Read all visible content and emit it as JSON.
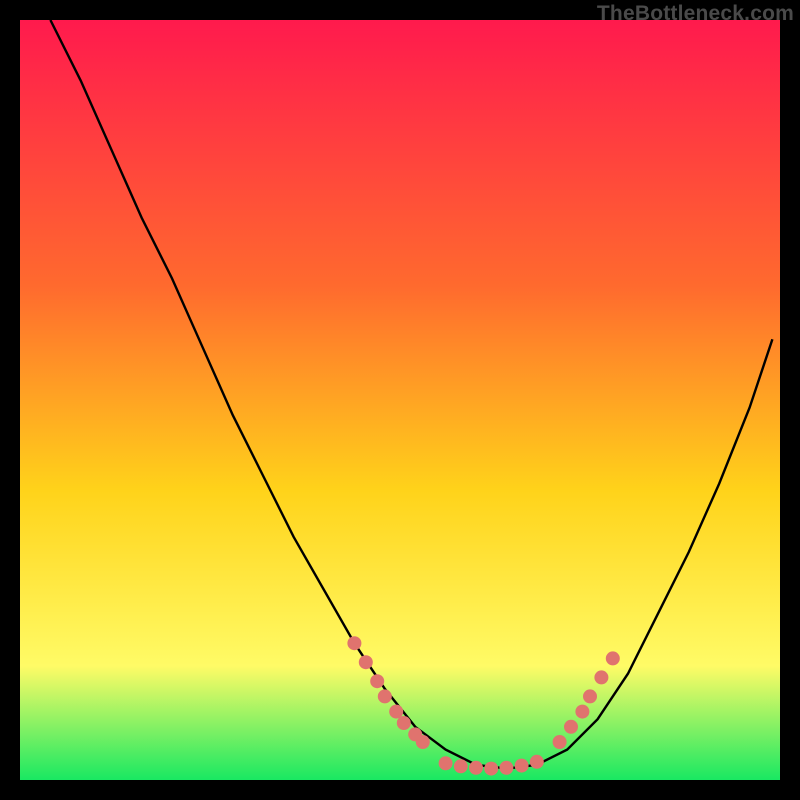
{
  "watermark": "TheBottleneck.com",
  "colors": {
    "gradient_top": "#ff1a4d",
    "gradient_mid1": "#ff6a2e",
    "gradient_mid2": "#ffd31a",
    "gradient_mid3": "#fffb66",
    "gradient_bottom": "#19e862",
    "curve": "#000000",
    "dots": "#e0736e",
    "frame": "#000000"
  },
  "chart_data": {
    "type": "line",
    "title": "",
    "xlabel": "",
    "ylabel": "",
    "xlim": [
      0,
      100
    ],
    "ylim": [
      0,
      100
    ],
    "curve": {
      "name": "bottleneck-curve",
      "x": [
        4,
        8,
        12,
        16,
        20,
        24,
        28,
        32,
        36,
        40,
        44,
        48,
        52,
        56,
        60,
        64,
        68,
        72,
        76,
        80,
        84,
        88,
        92,
        96,
        99
      ],
      "y": [
        100,
        92,
        83,
        74,
        66,
        57,
        48,
        40,
        32,
        25,
        18,
        12,
        7,
        4,
        2,
        1.5,
        2,
        4,
        8,
        14,
        22,
        30,
        39,
        49,
        58
      ]
    },
    "series": [
      {
        "name": "left-cluster",
        "type": "scatter",
        "x": [
          44,
          45.5,
          47,
          48,
          49.5,
          50.5,
          52,
          53
        ],
        "y": [
          18,
          15.5,
          13,
          11,
          9,
          7.5,
          6,
          5
        ]
      },
      {
        "name": "bottom-cluster",
        "type": "scatter",
        "x": [
          56,
          58,
          60,
          62,
          64,
          66,
          68
        ],
        "y": [
          2.2,
          1.8,
          1.6,
          1.5,
          1.6,
          1.9,
          2.4
        ]
      },
      {
        "name": "right-cluster",
        "type": "scatter",
        "x": [
          71,
          72.5,
          74,
          75,
          76.5,
          78
        ],
        "y": [
          5,
          7,
          9,
          11,
          13.5,
          16
        ]
      }
    ]
  }
}
